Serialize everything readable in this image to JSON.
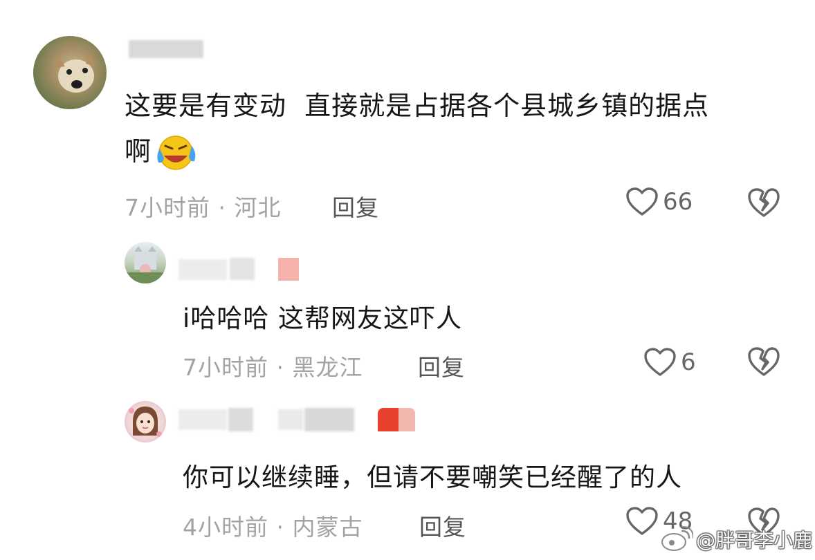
{
  "comments": [
    {
      "text_line1": "这要是有变动  直接就是占据各个县城乡镇的据点",
      "text_line2": "啊",
      "time": "7小时前",
      "separator": "·",
      "location": "河北",
      "reply_label": "回复",
      "likes": "66"
    },
    {
      "text": "i哈哈哈 这帮网友这吓人",
      "time": "7小时前",
      "separator": "·",
      "location": "黑龙江",
      "reply_label": "回复",
      "likes": "6"
    },
    {
      "text": "你可以继续睡，但请不要嘲笑已经醒了的人",
      "time": "4小时前",
      "separator": "·",
      "location": "内蒙古",
      "reply_label": "回复",
      "likes": "48"
    }
  ],
  "watermark": "@胖哥李小鹿",
  "colors": {
    "text": "#161616",
    "meta": "#a3a3a3",
    "icon": "#666666",
    "censor": "#d9d9d9",
    "badge_pink": "#f6b3ac",
    "badge_red": "#e8422f"
  },
  "icons": [
    "heart-outline-icon",
    "broken-heart-icon",
    "laugh-cry-emoji",
    "weibo-logo"
  ]
}
